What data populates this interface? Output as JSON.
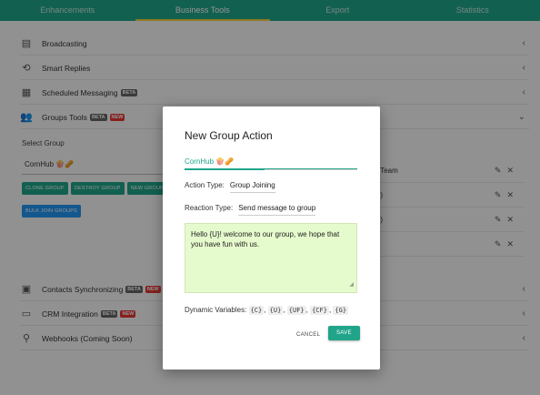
{
  "tabs": [
    {
      "label": "Enhancements"
    },
    {
      "label": "Business Tools"
    },
    {
      "label": "Export"
    },
    {
      "label": "Statistics"
    }
  ],
  "sections": {
    "broadcasting": "Broadcasting",
    "smart_replies": "Smart Replies",
    "scheduled_messaging": "Scheduled Messaging",
    "groups_tools": "Groups Tools",
    "contacts_sync": "Contacts Synchronizing",
    "crm": "CRM Integration",
    "webhooks": "Webhooks (Coming Soon)"
  },
  "badges": {
    "beta": "BETA",
    "new": "NEW"
  },
  "groups": {
    "select_label": "Select Group",
    "selected": "CornHub 🍿🥜",
    "buttons": {
      "clone": "CLONE GROUP",
      "destroy": "DESTROY GROUP",
      "new": "NEW GROUP",
      "bulk_join": "BULK JOIN GROUPS"
    },
    "rows": [
      "ers Team",
      "rnal)",
      "rnal)",
      ""
    ]
  },
  "dialog": {
    "title": "New Group Action",
    "tab_label": "CornHub 🍿🥜",
    "action_type_label": "Action Type:",
    "action_type_value": "Group Joining",
    "reaction_type_label": "Reaction Type:",
    "reaction_type_value": "Send message to group",
    "message": "Hello {U}! welcome to our group, we hope that you have fun with us.",
    "dynamic_label": "Dynamic Variables:",
    "vars": [
      "{C}",
      "{U}",
      "{UF}",
      "{CF}",
      "{G}"
    ],
    "cancel": "CANCEL",
    "save": "SAVE"
  }
}
